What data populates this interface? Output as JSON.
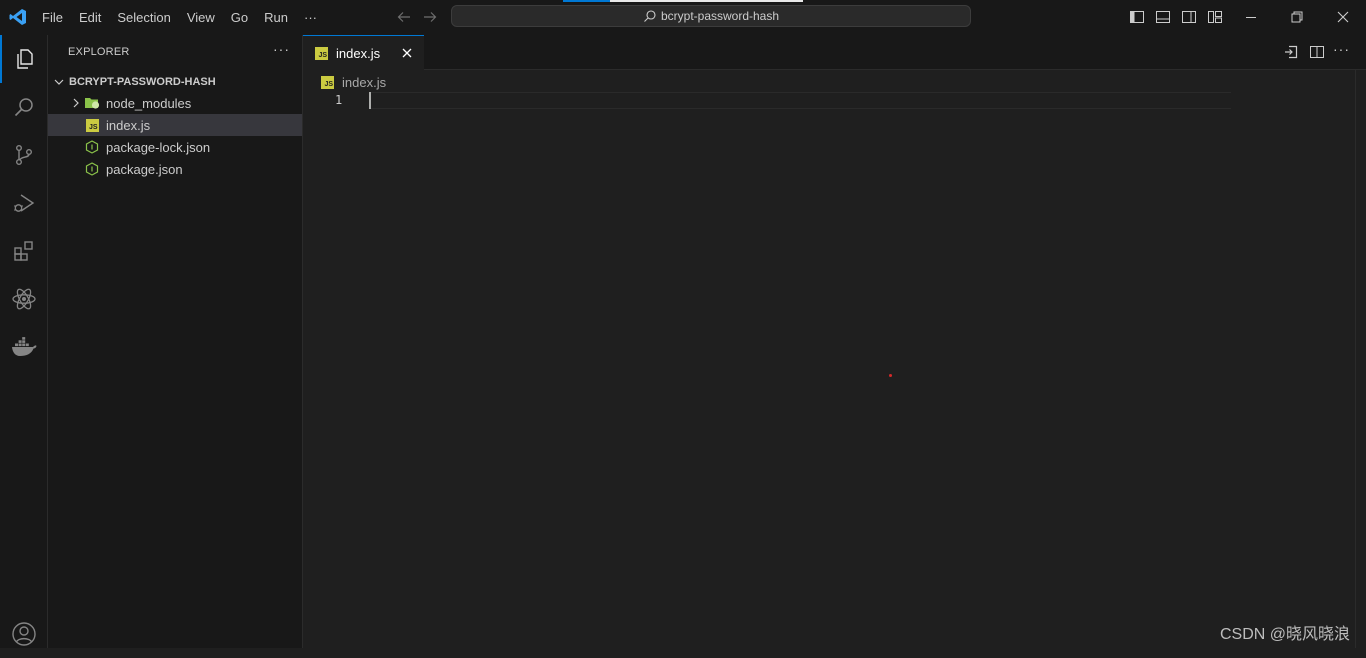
{
  "titlebar": {
    "menu": [
      "File",
      "Edit",
      "Selection",
      "View",
      "Go",
      "Run",
      "···"
    ],
    "command_center": "bcrypt-password-hash"
  },
  "sidebar": {
    "title": "EXPLORER",
    "more": "···",
    "root_folder": "BCRYPT-PASSWORD-HASH",
    "items": [
      {
        "label": "node_modules",
        "icon": "folder-node-icon"
      },
      {
        "label": "index.js",
        "icon": "js-file-icon"
      },
      {
        "label": "package-lock.json",
        "icon": "nodejs-icon"
      },
      {
        "label": "package.json",
        "icon": "nodejs-icon"
      }
    ]
  },
  "editor": {
    "tab_label": "index.js",
    "tab_icon_text": "JS",
    "breadcrumb": "index.js",
    "line_number": "1"
  },
  "colors": {
    "accent": "#0078d4",
    "js_icon": "#cbcb41",
    "node_icon": "#8bc34a"
  },
  "watermark": "CSDN @晓风晓浪"
}
